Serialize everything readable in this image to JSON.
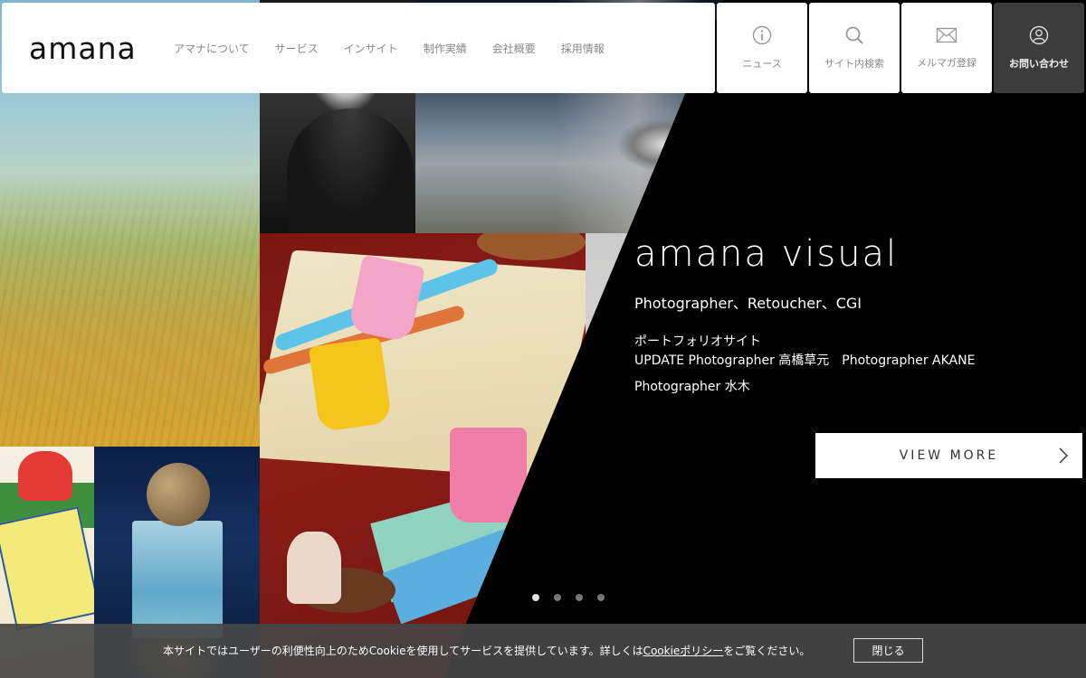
{
  "brand": {
    "logo_text": "amana"
  },
  "nav": {
    "items": [
      {
        "label": "アマナについて"
      },
      {
        "label": "サービス"
      },
      {
        "label": "インサイト"
      },
      {
        "label": "制作実績"
      },
      {
        "label": "会社概要"
      },
      {
        "label": "採用情報"
      }
    ]
  },
  "utility": {
    "news": {
      "label": "ニュース",
      "icon": "info-icon"
    },
    "search": {
      "label": "サイト内検索",
      "icon": "search-icon"
    },
    "mail": {
      "label": "メルマガ登録",
      "icon": "mail-icon"
    },
    "contact": {
      "label": "お問い合わせ",
      "icon": "user-icon"
    }
  },
  "hero": {
    "title": "amana visual",
    "subtitle": "Photographer、Retoucher、CGI",
    "portfolio_label": "ポートフォリオサイト",
    "update_line": "UPDATE Photographer 高橋草元　Photographer AKANE",
    "third_line": "Photographer 水木",
    "cta_label": "VIEW MORE"
  },
  "carousel": {
    "slide_count": 4,
    "active_index": 0
  },
  "cookie_bar": {
    "message_before": "本サイトではユーザーの利便性向上のためCookieを使用してサービスを提供しています。詳しくは",
    "policy_link": "Cookieポリシー",
    "message_after": "をご覧ください。",
    "close_label": "閉じる"
  },
  "colors": {
    "background": "#000000",
    "header_bg": "#ffffff",
    "contact_bg": "#3c3c3c",
    "cookie_bg": "#464646"
  }
}
